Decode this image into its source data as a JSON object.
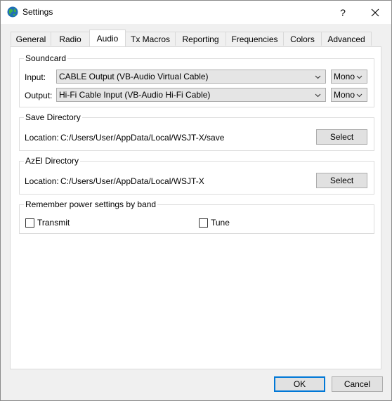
{
  "window": {
    "title": "Settings",
    "help": "?",
    "close": "✕"
  },
  "tabs": [
    {
      "label": "General"
    },
    {
      "label": "Radio"
    },
    {
      "label": "Audio"
    },
    {
      "label": "Tx Macros"
    },
    {
      "label": "Reporting"
    },
    {
      "label": "Frequencies"
    },
    {
      "label": "Colors"
    },
    {
      "label": "Advanced"
    }
  ],
  "active_tab": "Audio",
  "soundcard": {
    "title": "Soundcard",
    "input_label": "Input:",
    "input_value": "CABLE Output (VB-Audio Virtual Cable)",
    "input_channel": "Mono",
    "output_label": "Output:",
    "output_value": "Hi-Fi Cable Input (VB-Audio Hi-Fi Cable)",
    "output_channel": "Mono"
  },
  "save_dir": {
    "title": "Save Directory",
    "location_label": "Location:",
    "location_value": "C:/Users/User/AppData/Local/WSJT-X/save",
    "button": "Select"
  },
  "azel_dir": {
    "title": "AzEl Directory",
    "location_label": "Location:",
    "location_value": "C:/Users/User/AppData/Local/WSJT-X",
    "button": "Select"
  },
  "power": {
    "title": "Remember power settings by band",
    "transmit_label": "Transmit",
    "tune_label": "Tune"
  },
  "footer": {
    "ok": "OK",
    "cancel": "Cancel"
  }
}
